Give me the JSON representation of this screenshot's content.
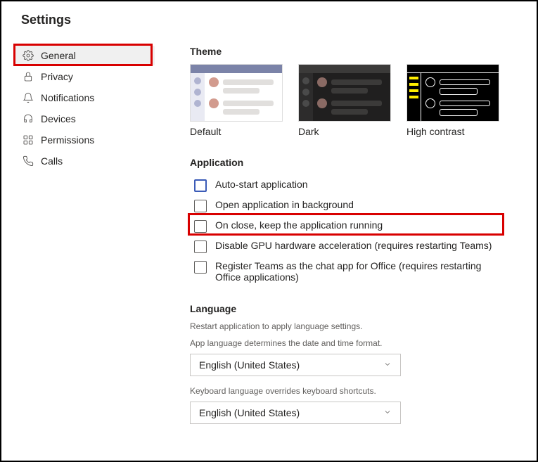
{
  "title": "Settings",
  "sidebar": {
    "items": [
      {
        "label": "General"
      },
      {
        "label": "Privacy"
      },
      {
        "label": "Notifications"
      },
      {
        "label": "Devices"
      },
      {
        "label": "Permissions"
      },
      {
        "label": "Calls"
      }
    ]
  },
  "theme": {
    "heading": "Theme",
    "options": [
      {
        "label": "Default"
      },
      {
        "label": "Dark"
      },
      {
        "label": "High contrast"
      }
    ]
  },
  "application": {
    "heading": "Application",
    "options": [
      {
        "label": "Auto-start application"
      },
      {
        "label": "Open application in background"
      },
      {
        "label": "On close, keep the application running"
      },
      {
        "label": "Disable GPU hardware acceleration (requires restarting Teams)"
      },
      {
        "label": "Register Teams as the chat app for Office (requires restarting Office applications)"
      }
    ]
  },
  "language": {
    "heading": "Language",
    "restart_note": "Restart application to apply language settings.",
    "app_lang_note": "App language determines the date and time format.",
    "app_lang_value": "English (United States)",
    "kb_lang_note": "Keyboard language overrides keyboard shortcuts.",
    "kb_lang_value": "English (United States)"
  }
}
